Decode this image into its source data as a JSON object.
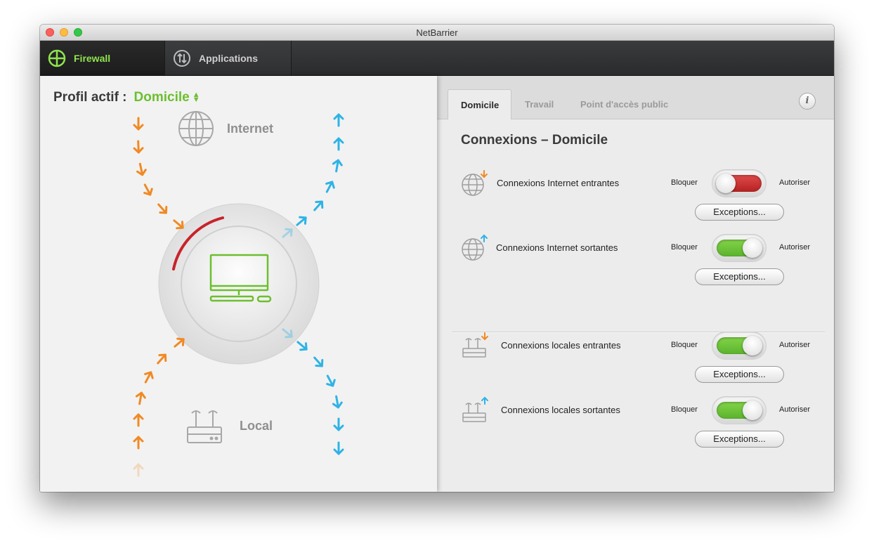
{
  "window": {
    "title": "NetBarrier"
  },
  "toolbar": {
    "tabs": [
      {
        "label": "Firewall",
        "icon": "firewall-icon",
        "active": true
      },
      {
        "label": "Applications",
        "icon": "applications-icon",
        "active": false
      }
    ]
  },
  "left": {
    "profile_label": "Profil actif :",
    "profile_value": "Domicile",
    "internet_label": "Internet",
    "local_label": "Local"
  },
  "right": {
    "tabs": [
      {
        "label": "Domicile",
        "active": true
      },
      {
        "label": "Travail",
        "active": false
      },
      {
        "label": "Point d'accès public",
        "active": false
      }
    ],
    "info_label": "i",
    "section_title": "Connexions – Domicile",
    "rows": [
      {
        "label": "Connexions Internet entrantes",
        "icon": "globe-incoming-icon",
        "block_label": "Bloquer",
        "allow_label": "Autoriser",
        "state": "off",
        "exceptions_label": "Exceptions..."
      },
      {
        "label": "Connexions Internet sortantes",
        "icon": "globe-outgoing-icon",
        "block_label": "Bloquer",
        "allow_label": "Autoriser",
        "state": "on",
        "exceptions_label": "Exceptions..."
      },
      {
        "label": "Connexions locales entrantes",
        "icon": "router-incoming-icon",
        "block_label": "Bloquer",
        "allow_label": "Autoriser",
        "state": "on",
        "exceptions_label": "Exceptions..."
      },
      {
        "label": "Connexions locales sortantes",
        "icon": "router-outgoing-icon",
        "block_label": "Bloquer",
        "allow_label": "Autoriser",
        "state": "on",
        "exceptions_label": "Exceptions..."
      }
    ]
  },
  "colors": {
    "accent_green": "#6cbf2f",
    "incoming_orange": "#f08a24",
    "outgoing_blue": "#2fb3e6",
    "blocked_red": "#c8232b"
  }
}
